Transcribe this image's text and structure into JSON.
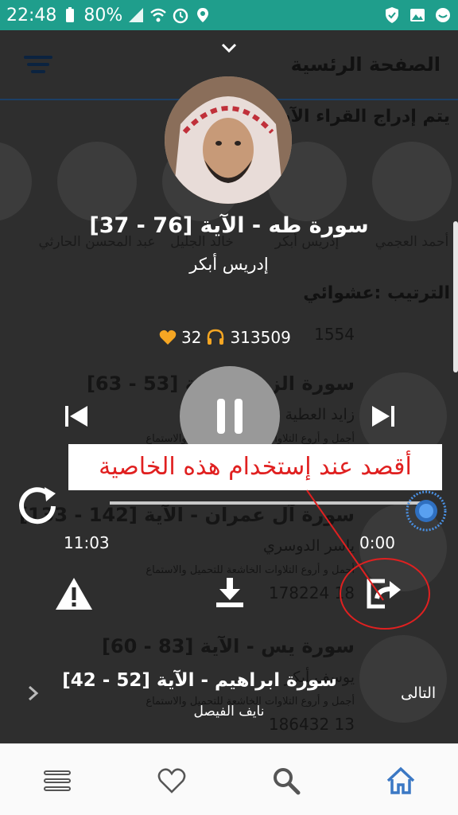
{
  "status_bar": {
    "time": "22:48",
    "battery": "80%",
    "icons": [
      "battery-icon",
      "signal-icon",
      "wifi-icon",
      "alarm-icon",
      "location-icon",
      "shield-icon",
      "image-icon",
      "sync-icon"
    ]
  },
  "background_page": {
    "title": "الصفحة الرئسية",
    "section_subtitle": "يتم إدراج القراء الآن",
    "readers": [
      "أحمد العجمي",
      "إدريس أبكر",
      "خالد الجليل",
      "عبد المحسن الحارثي",
      "مح"
    ],
    "sort_label": "الترتيب :عشوائي",
    "items": [
      {
        "title": "سورة الزمر - الآية [53 - 63]",
        "artist": "زايد العطية",
        "desc": "أجمل و أروع التلاوات الخاشعة للتحميل والاستماع",
        "stats": "1554"
      },
      {
        "title": "سورة آل عمران - الآية [142 - 133]",
        "artist": "ياسر الدوسري",
        "desc": "أجمل و أروع التلاوات الخاشعة للتحميل والاستماع",
        "stats": "178224   18"
      },
      {
        "title": "سورة يس - الآية [83 - 60]",
        "artist": "يوسف أبكر",
        "desc": "أجمل و أروع التلاوات الخاشعة للتحميل والاستماع",
        "stats": "186432   13"
      }
    ]
  },
  "player": {
    "track_title": "سورة طه - الآية  [76 - 37]",
    "artist": "إدريس أبكر",
    "listens": "313509",
    "likes": "32",
    "current_time": "11:03",
    "remaining_time": "0:00",
    "progress": 1.0,
    "annotation": "أقصد عند إستخدام هذه الخاصية",
    "next_track": {
      "title": "سورة ابراهيم - الآية [52 - 42]",
      "artist": "نايف الفيصل",
      "label": "التالى"
    }
  },
  "colors": {
    "status_bar": "#1f9e8c",
    "accent": "#4a90e2",
    "heart": "#f5a623",
    "annotation": "#e02020"
  },
  "bottom_nav": [
    "list-icon",
    "heart-icon",
    "search-icon",
    "home-icon"
  ]
}
